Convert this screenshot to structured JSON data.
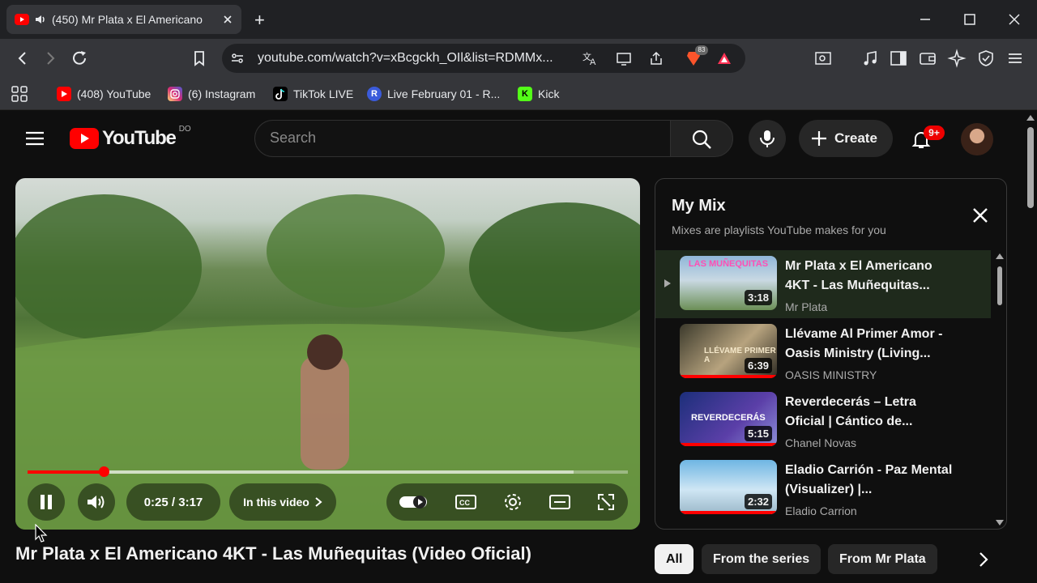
{
  "browser": {
    "tab_title": "(450) Mr Plata x El Americano",
    "url": "youtube.com/watch?v=xBcgckh_OIl&list=RDMMx...",
    "new_tab_symbol": "+",
    "brave_badge": "83",
    "bookmarks": [
      {
        "label": "(408) YouTube",
        "icon": "youtube-icon",
        "color": "#ff0000"
      },
      {
        "label": "(6) Instagram",
        "icon": "instagram-icon",
        "color": "#d62976"
      },
      {
        "label": "TikTok LIVE",
        "icon": "tiktok-icon",
        "color": "#000000"
      },
      {
        "label": "Live February 01 - R...",
        "icon": "rumble-r-icon",
        "color": "#3b5bdb"
      },
      {
        "label": "Kick",
        "icon": "kick-icon",
        "color": "#53fc18"
      }
    ]
  },
  "youtube": {
    "logo_text": "YouTube",
    "region": "DO",
    "search_placeholder": "Search",
    "create_label": "Create",
    "notification_badge": "9+",
    "player": {
      "current_time": "0:25",
      "duration": "3:17",
      "time_display": "0:25 / 3:17",
      "progress_fraction": 0.127,
      "buffered_fraction": 0.91,
      "chapter_label": "In this video"
    },
    "video_title": "Mr Plata x El Americano 4KT - Las Muñequitas (Video Oficial)",
    "mix": {
      "title": "My Mix",
      "subtitle": "Mixes are playlists YouTube makes for you",
      "items": [
        {
          "title": "Mr Plata x El Americano 4KT - Las Muñequitas...",
          "channel": "Mr Plata",
          "duration": "3:18",
          "thumb_text": "LAS MUÑEQUITAS",
          "active": true
        },
        {
          "title": "Llévame Al Primer Amor - Oasis Ministry (Living...",
          "channel": "OASIS MINISTRY",
          "duration": "6:39",
          "thumb_text": "LLÉVAME PRIMER A",
          "active": false
        },
        {
          "title": "Reverdecerás – Letra Oficial | Cántico de...",
          "channel": "Chanel Novas",
          "duration": "5:15",
          "thumb_text": "REVERDECERÁS",
          "active": false
        },
        {
          "title": "Eladio Carrión - Paz Mental (Visualizer) |...",
          "channel": "Eladio Carrion",
          "duration": "2:32",
          "thumb_text": "",
          "active": false
        }
      ]
    },
    "chips": [
      "All",
      "From the series",
      "From Mr Plata"
    ],
    "colors": {
      "accent": "#ff0000",
      "background": "#0f0f0f"
    }
  }
}
